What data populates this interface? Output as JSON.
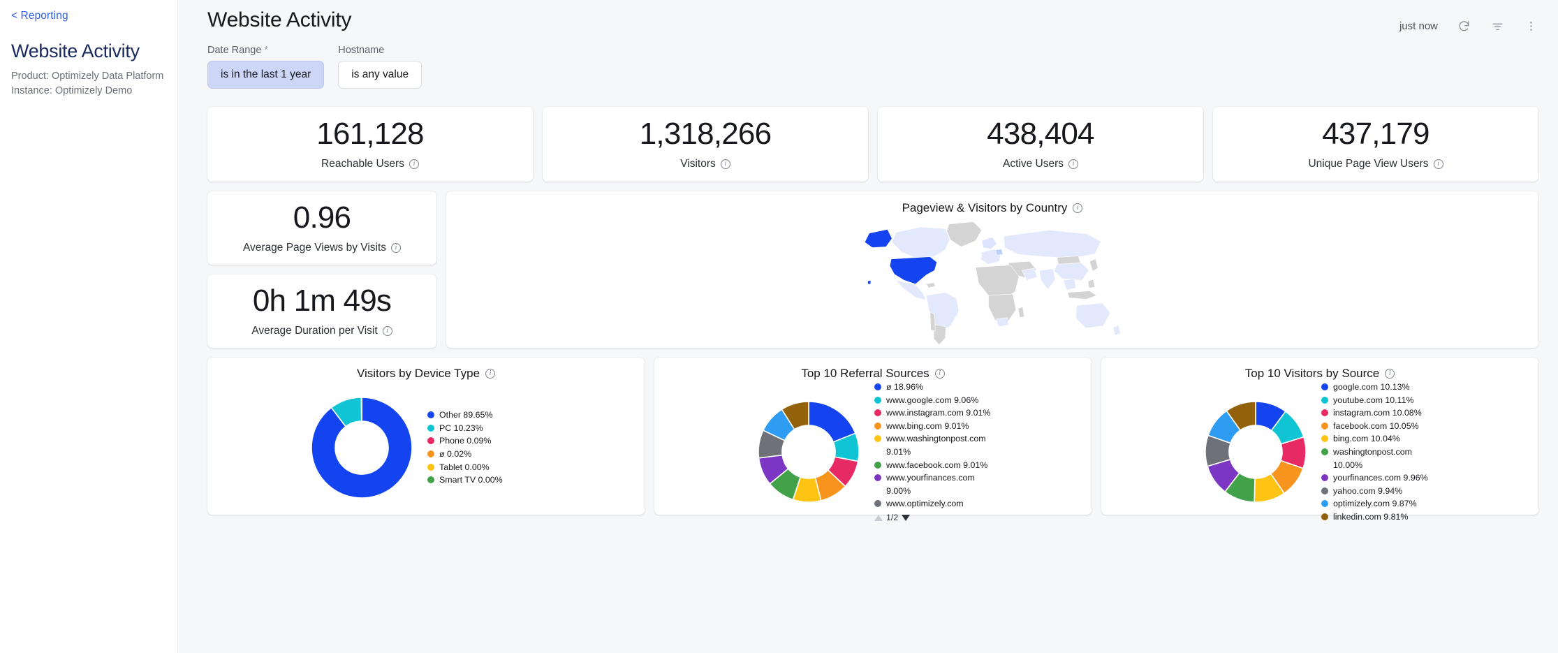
{
  "sidebar": {
    "back_link": "< Reporting",
    "title": "Website Activity",
    "product": "Product: Optimizely Data Platform",
    "instance": "Instance: Optimizely Demo"
  },
  "header": {
    "title": "Website Activity",
    "refresh_status": "just now",
    "refresh_icon": "refresh-icon",
    "filter_icon": "filter-icon",
    "more_icon": "more-vertical-icon"
  },
  "filters": [
    {
      "label": "Date Range",
      "required": "*",
      "value": "is in the last 1 year",
      "active": true
    },
    {
      "label": "Hostname",
      "required": "",
      "value": "is any value",
      "active": false
    }
  ],
  "kpis_row1": [
    {
      "value": "161,128",
      "label": "Reachable Users"
    },
    {
      "value": "1,318,266",
      "label": "Visitors"
    },
    {
      "value": "438,404",
      "label": "Active Users"
    },
    {
      "value": "437,179",
      "label": "Unique Page View Users"
    }
  ],
  "kpis_row2": [
    {
      "value": "0.96",
      "label": "Average Page Views by Visits"
    },
    {
      "value": "0h 1m 49s",
      "label": "Average Duration per Visit"
    }
  ],
  "map_panel": {
    "title": "Pageview & Visitors by Country"
  },
  "colors": {
    "accent_blue": "#1344f0",
    "cyan": "#11c4d4",
    "pink": "#e82a64",
    "orange": "#f7941d",
    "yellow": "#fdc413",
    "green": "#42a24a",
    "purple": "#7b37c4",
    "gray": "#6e7178",
    "light_blue": "#2f9cf4",
    "brown": "#93610a",
    "map_high": "#1344f0",
    "map_low": "#e2e9fd",
    "map_none": "#d4d4d4",
    "chip_active_bg": "#cdd6f7",
    "sidebar_title": "#1b2a5e",
    "link": "#2f5ee8"
  },
  "chart_data": [
    {
      "type": "pie",
      "title": "Visitors by Device Type",
      "legend_position": "right",
      "categories": [
        "Other",
        "PC",
        "Phone",
        "ø",
        "Tablet",
        "Smart TV"
      ],
      "values": [
        89.65,
        10.23,
        0.09,
        0.02,
        0.0,
        0.0
      ],
      "labels": [
        "Other 89.65%",
        "PC 10.23%",
        "Phone 0.09%",
        "ø 0.02%",
        "Tablet 0.00%",
        "Smart TV 0.00%"
      ],
      "colors": [
        "#1344f0",
        "#11c4d4",
        "#e82a64",
        "#f7941d",
        "#fdc413",
        "#42a24a"
      ]
    },
    {
      "type": "pie",
      "title": "Top 10 Referral Sources",
      "legend_position": "right",
      "pager": "1/2",
      "categories": [
        "ø",
        "www.google.com",
        "www.instagram.com",
        "www.bing.com",
        "www.washingtonpost.com",
        "www.facebook.com",
        "www.yourfinances.com",
        "www.optimizely.com",
        "",
        ""
      ],
      "values": [
        18.96,
        9.06,
        9.01,
        9.01,
        9.01,
        9.01,
        9.0,
        8.99,
        8.98,
        8.98
      ],
      "labels": [
        "ø 18.96%",
        "www.google.com 9.06%",
        "www.instagram.com 9.01%",
        "www.bing.com 9.01%",
        "www.washingtonpost.com 9.01%",
        "www.facebook.com 9.01%",
        "www.yourfinances.com 9.00%",
        "www.optimizely.com"
      ],
      "colors": [
        "#1344f0",
        "#11c4d4",
        "#e82a64",
        "#f7941d",
        "#fdc413",
        "#42a24a",
        "#7b37c4",
        "#6e7178",
        "#2f9cf4",
        "#93610a"
      ]
    },
    {
      "type": "pie",
      "title": "Top 10 Visitors by Source",
      "legend_position": "right",
      "categories": [
        "google.com",
        "youtube.com",
        "instagram.com",
        "facebook.com",
        "bing.com",
        "washingtonpost.com",
        "yourfinances.com",
        "yahoo.com",
        "optimizely.com",
        "linkedin.com"
      ],
      "values": [
        10.13,
        10.11,
        10.08,
        10.05,
        10.04,
        10.0,
        9.96,
        9.94,
        9.87,
        9.81
      ],
      "labels": [
        "google.com 10.13%",
        "youtube.com 10.11%",
        "instagram.com 10.08%",
        "facebook.com 10.05%",
        "bing.com 10.04%",
        "washingtonpost.com 10.00%",
        "yourfinances.com 9.96%",
        "yahoo.com 9.94%",
        "optimizely.com 9.87%",
        "linkedin.com 9.81%"
      ],
      "colors": [
        "#1344f0",
        "#11c4d4",
        "#e82a64",
        "#f7941d",
        "#fdc413",
        "#42a24a",
        "#7b37c4",
        "#6e7178",
        "#2f9cf4",
        "#93610a"
      ]
    }
  ]
}
